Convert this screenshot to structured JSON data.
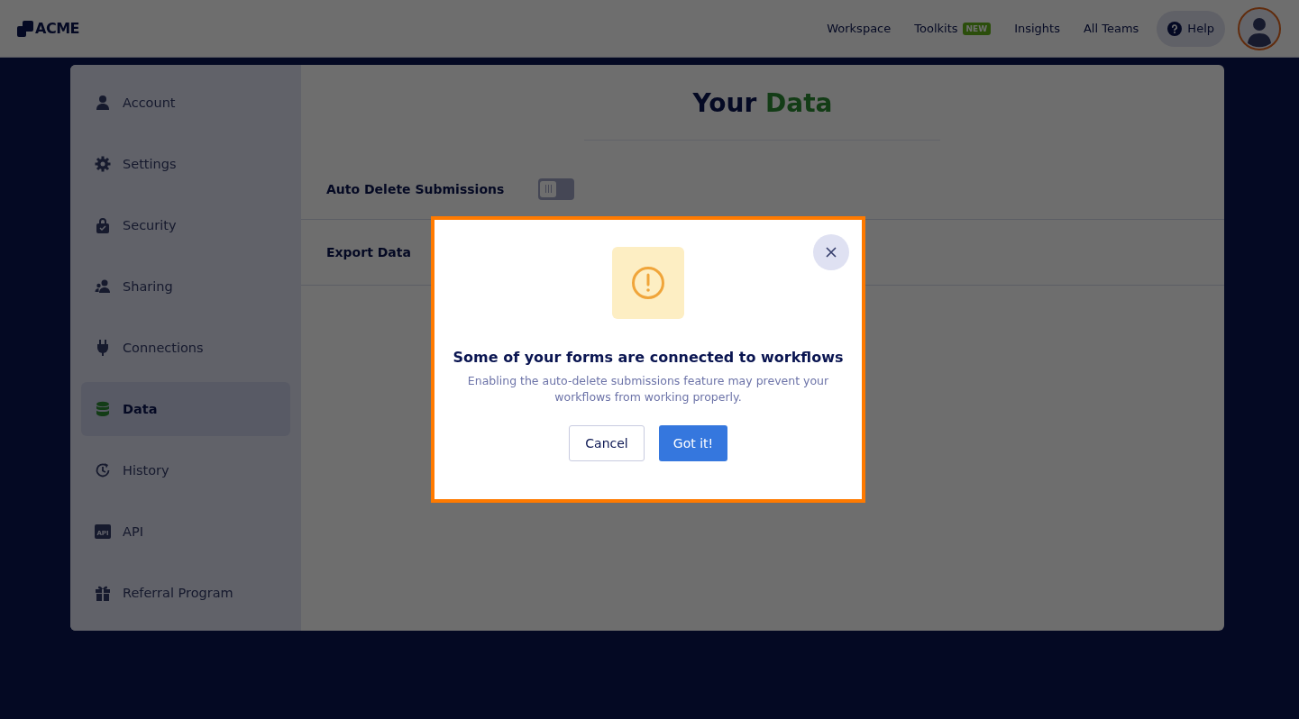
{
  "header": {
    "logo": "ACME",
    "nav": [
      {
        "label": "Workspace"
      },
      {
        "label": "Toolkits",
        "badge": "NEW"
      },
      {
        "label": "Insights"
      },
      {
        "label": "All Teams"
      }
    ],
    "help": "Help"
  },
  "sidebar": {
    "items": [
      {
        "label": "Account",
        "kind": "person",
        "selected": false
      },
      {
        "label": "Settings",
        "kind": "gear",
        "selected": false
      },
      {
        "label": "Security",
        "kind": "lock",
        "selected": false
      },
      {
        "label": "Sharing",
        "kind": "people",
        "selected": false
      },
      {
        "label": "Connections",
        "kind": "plug",
        "selected": false
      },
      {
        "label": "Data",
        "kind": "database",
        "selected": true
      },
      {
        "label": "History",
        "kind": "history",
        "selected": false
      },
      {
        "label": "API",
        "kind": "api",
        "icon_text": "API",
        "selected": false
      },
      {
        "label": "Referral Program",
        "kind": "gift",
        "selected": false
      }
    ]
  },
  "content": {
    "title_lead": "Your",
    "title_accent": "Data",
    "rows": [
      {
        "label": "Auto Delete Submissions",
        "kind": "toggle",
        "on": false
      },
      {
        "label": "Export Data",
        "kind": "plain"
      }
    ]
  },
  "dialog": {
    "title": "Some of your forms are connected to workflows",
    "message": "Enabling the auto-delete submissions feature may prevent your workflows from working properly.",
    "buttons": [
      {
        "label": "Cancel",
        "kind": "secondary"
      },
      {
        "label": "Got it!",
        "kind": "primary"
      }
    ]
  }
}
